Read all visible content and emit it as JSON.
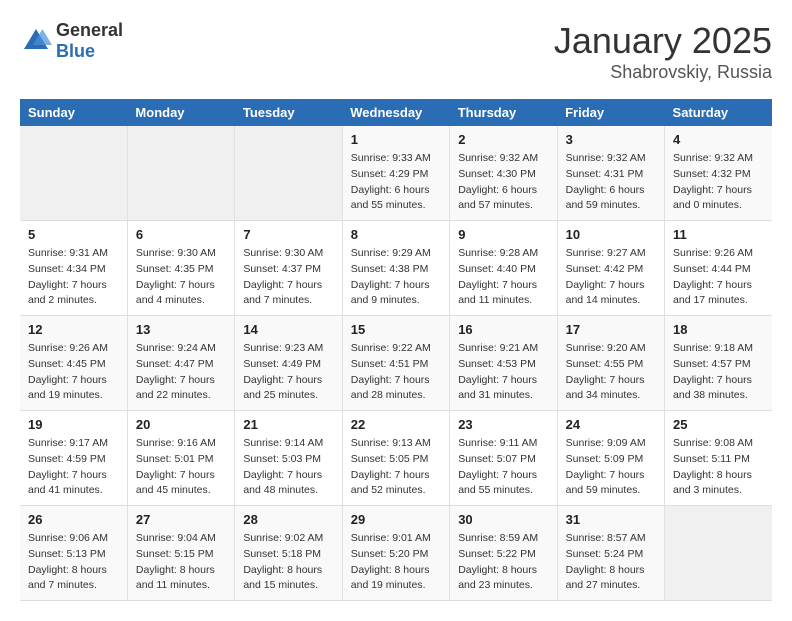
{
  "header": {
    "logo": {
      "general": "General",
      "blue": "Blue"
    },
    "month": "January 2025",
    "location": "Shabrovskiy, Russia"
  },
  "weekdays": [
    "Sunday",
    "Monday",
    "Tuesday",
    "Wednesday",
    "Thursday",
    "Friday",
    "Saturday"
  ],
  "weeks": [
    [
      {
        "day": "",
        "info": ""
      },
      {
        "day": "",
        "info": ""
      },
      {
        "day": "",
        "info": ""
      },
      {
        "day": "1",
        "info": "Sunrise: 9:33 AM\nSunset: 4:29 PM\nDaylight: 6 hours\nand 55 minutes."
      },
      {
        "day": "2",
        "info": "Sunrise: 9:32 AM\nSunset: 4:30 PM\nDaylight: 6 hours\nand 57 minutes."
      },
      {
        "day": "3",
        "info": "Sunrise: 9:32 AM\nSunset: 4:31 PM\nDaylight: 6 hours\nand 59 minutes."
      },
      {
        "day": "4",
        "info": "Sunrise: 9:32 AM\nSunset: 4:32 PM\nDaylight: 7 hours\nand 0 minutes."
      }
    ],
    [
      {
        "day": "5",
        "info": "Sunrise: 9:31 AM\nSunset: 4:34 PM\nDaylight: 7 hours\nand 2 minutes."
      },
      {
        "day": "6",
        "info": "Sunrise: 9:30 AM\nSunset: 4:35 PM\nDaylight: 7 hours\nand 4 minutes."
      },
      {
        "day": "7",
        "info": "Sunrise: 9:30 AM\nSunset: 4:37 PM\nDaylight: 7 hours\nand 7 minutes."
      },
      {
        "day": "8",
        "info": "Sunrise: 9:29 AM\nSunset: 4:38 PM\nDaylight: 7 hours\nand 9 minutes."
      },
      {
        "day": "9",
        "info": "Sunrise: 9:28 AM\nSunset: 4:40 PM\nDaylight: 7 hours\nand 11 minutes."
      },
      {
        "day": "10",
        "info": "Sunrise: 9:27 AM\nSunset: 4:42 PM\nDaylight: 7 hours\nand 14 minutes."
      },
      {
        "day": "11",
        "info": "Sunrise: 9:26 AM\nSunset: 4:44 PM\nDaylight: 7 hours\nand 17 minutes."
      }
    ],
    [
      {
        "day": "12",
        "info": "Sunrise: 9:26 AM\nSunset: 4:45 PM\nDaylight: 7 hours\nand 19 minutes."
      },
      {
        "day": "13",
        "info": "Sunrise: 9:24 AM\nSunset: 4:47 PM\nDaylight: 7 hours\nand 22 minutes."
      },
      {
        "day": "14",
        "info": "Sunrise: 9:23 AM\nSunset: 4:49 PM\nDaylight: 7 hours\nand 25 minutes."
      },
      {
        "day": "15",
        "info": "Sunrise: 9:22 AM\nSunset: 4:51 PM\nDaylight: 7 hours\nand 28 minutes."
      },
      {
        "day": "16",
        "info": "Sunrise: 9:21 AM\nSunset: 4:53 PM\nDaylight: 7 hours\nand 31 minutes."
      },
      {
        "day": "17",
        "info": "Sunrise: 9:20 AM\nSunset: 4:55 PM\nDaylight: 7 hours\nand 34 minutes."
      },
      {
        "day": "18",
        "info": "Sunrise: 9:18 AM\nSunset: 4:57 PM\nDaylight: 7 hours\nand 38 minutes."
      }
    ],
    [
      {
        "day": "19",
        "info": "Sunrise: 9:17 AM\nSunset: 4:59 PM\nDaylight: 7 hours\nand 41 minutes."
      },
      {
        "day": "20",
        "info": "Sunrise: 9:16 AM\nSunset: 5:01 PM\nDaylight: 7 hours\nand 45 minutes."
      },
      {
        "day": "21",
        "info": "Sunrise: 9:14 AM\nSunset: 5:03 PM\nDaylight: 7 hours\nand 48 minutes."
      },
      {
        "day": "22",
        "info": "Sunrise: 9:13 AM\nSunset: 5:05 PM\nDaylight: 7 hours\nand 52 minutes."
      },
      {
        "day": "23",
        "info": "Sunrise: 9:11 AM\nSunset: 5:07 PM\nDaylight: 7 hours\nand 55 minutes."
      },
      {
        "day": "24",
        "info": "Sunrise: 9:09 AM\nSunset: 5:09 PM\nDaylight: 7 hours\nand 59 minutes."
      },
      {
        "day": "25",
        "info": "Sunrise: 9:08 AM\nSunset: 5:11 PM\nDaylight: 8 hours\nand 3 minutes."
      }
    ],
    [
      {
        "day": "26",
        "info": "Sunrise: 9:06 AM\nSunset: 5:13 PM\nDaylight: 8 hours\nand 7 minutes."
      },
      {
        "day": "27",
        "info": "Sunrise: 9:04 AM\nSunset: 5:15 PM\nDaylight: 8 hours\nand 11 minutes."
      },
      {
        "day": "28",
        "info": "Sunrise: 9:02 AM\nSunset: 5:18 PM\nDaylight: 8 hours\nand 15 minutes."
      },
      {
        "day": "29",
        "info": "Sunrise: 9:01 AM\nSunset: 5:20 PM\nDaylight: 8 hours\nand 19 minutes."
      },
      {
        "day": "30",
        "info": "Sunrise: 8:59 AM\nSunset: 5:22 PM\nDaylight: 8 hours\nand 23 minutes."
      },
      {
        "day": "31",
        "info": "Sunrise: 8:57 AM\nSunset: 5:24 PM\nDaylight: 8 hours\nand 27 minutes."
      },
      {
        "day": "",
        "info": ""
      }
    ]
  ]
}
